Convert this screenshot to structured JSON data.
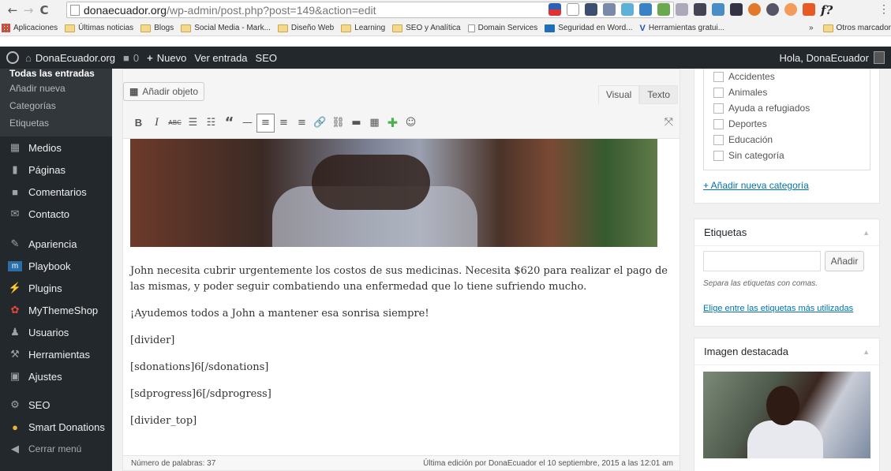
{
  "browser": {
    "url_host": "donaecuador.org",
    "url_path": "/wp-admin/post.php?post=149&action=edit",
    "bookmarks": [
      "Aplicaciones",
      "Últimas noticias",
      "Blogs",
      "Social Media - Mark...",
      "Diseño Web",
      "Learning",
      "SEO y Analítica",
      "Domain Services",
      "Seguridad en Word...",
      "Herramientas gratui..."
    ],
    "bookmarks_overflow": "»",
    "other_bookmarks": "Otros marcador",
    "f_label": "f?"
  },
  "adminbar": {
    "site_name": "DonaEcuador.org",
    "comments_count": "0",
    "new_label": "Nuevo",
    "view_post": "Ver entrada",
    "seo": "SEO",
    "howdy": "Hola, DonaEcuador"
  },
  "sidebar": {
    "submenu": [
      "Todas las entradas",
      "Añadir nueva",
      "Categorías",
      "Etiquetas"
    ],
    "items": [
      {
        "label": "Medios",
        "icon": "media-icon"
      },
      {
        "label": "Páginas",
        "icon": "pages-icon"
      },
      {
        "label": "Comentarios",
        "icon": "comments-icon"
      },
      {
        "label": "Contacto",
        "icon": "mail-icon"
      },
      {
        "label": "Apariencia",
        "icon": "brush-icon"
      },
      {
        "label": "Playbook",
        "icon": "playbook-icon"
      },
      {
        "label": "Plugins",
        "icon": "plugin-icon"
      },
      {
        "label": "MyThemeShop",
        "icon": "mythemeshop-icon"
      },
      {
        "label": "Usuarios",
        "icon": "users-icon"
      },
      {
        "label": "Herramientas",
        "icon": "wrench-icon"
      },
      {
        "label": "Ajustes",
        "icon": "settings-icon"
      },
      {
        "label": "SEO",
        "icon": "seo-icon"
      },
      {
        "label": "Smart Donations",
        "icon": "donations-icon"
      }
    ],
    "collapse": "Cerrar menú"
  },
  "editor": {
    "add_media": "Añadir objeto",
    "tab_visual": "Visual",
    "tab_text": "Texto",
    "paragraphs": [
      "John necesita cubrir urgentemente los costos de sus medicinas. Necesita $620 para realizar el pago de las mismas, y poder seguir combatiendo una enfermedad que lo tiene sufriendo mucho.",
      "¡Ayudemos todos a John a mantener esa sonrisa siempre!",
      "[divider]",
      "[sdonations]6[/sdonations]",
      "[sdprogress]6[/sdprogress]",
      "[divider_top]"
    ],
    "word_count": "Número de palabras: 37",
    "last_edit": "Última edición por DonaEcuador el 10 septiembre, 2015 a las 12:01 am"
  },
  "categories": {
    "items": [
      "Accidentes",
      "Animales",
      "Ayuda a refugiados",
      "Deportes",
      "Educación",
      "Sin categoría"
    ],
    "add_new": "+ Añadir nueva categoría"
  },
  "tags": {
    "title": "Etiquetas",
    "add_button": "Añadir",
    "hint": "Separa las etiquetas con comas.",
    "choose_link": "Elige entre las etiquetas más utilizadas"
  },
  "featured_image": {
    "title": "Imagen destacada"
  }
}
